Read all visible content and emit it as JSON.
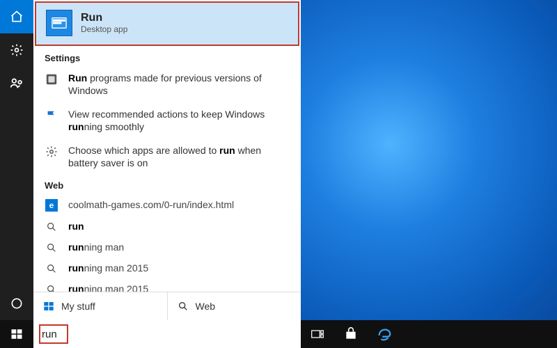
{
  "best_match": {
    "title": "Run",
    "subtitle": "Desktop app"
  },
  "sections": {
    "settings_header": "Settings",
    "settings": [
      {
        "html": "<strong>Run</strong> programs made for previous versions of Windows"
      },
      {
        "html": "View recommended actions to keep Windows <strong>run</strong>ning smoothly"
      },
      {
        "html": "Choose which apps are allowed to <strong>run</strong> when battery saver is on"
      }
    ],
    "web_header": "Web",
    "web": [
      {
        "icon": "edge",
        "html": "coolmath-games.com/0-run/index.html"
      },
      {
        "icon": "search",
        "html": "<strong>run</strong>"
      },
      {
        "icon": "search",
        "html": "<strong>run</strong>ning man"
      },
      {
        "icon": "search",
        "html": "<strong>run</strong>ning man 2015"
      },
      {
        "icon": "search",
        "html": "<strong>run</strong>ning man 2015"
      },
      {
        "icon": "search",
        "html": ""
      }
    ]
  },
  "filters": {
    "mystuff": "My stuff",
    "web": "Web"
  },
  "search": {
    "value": "run"
  },
  "edge_letter": "e"
}
